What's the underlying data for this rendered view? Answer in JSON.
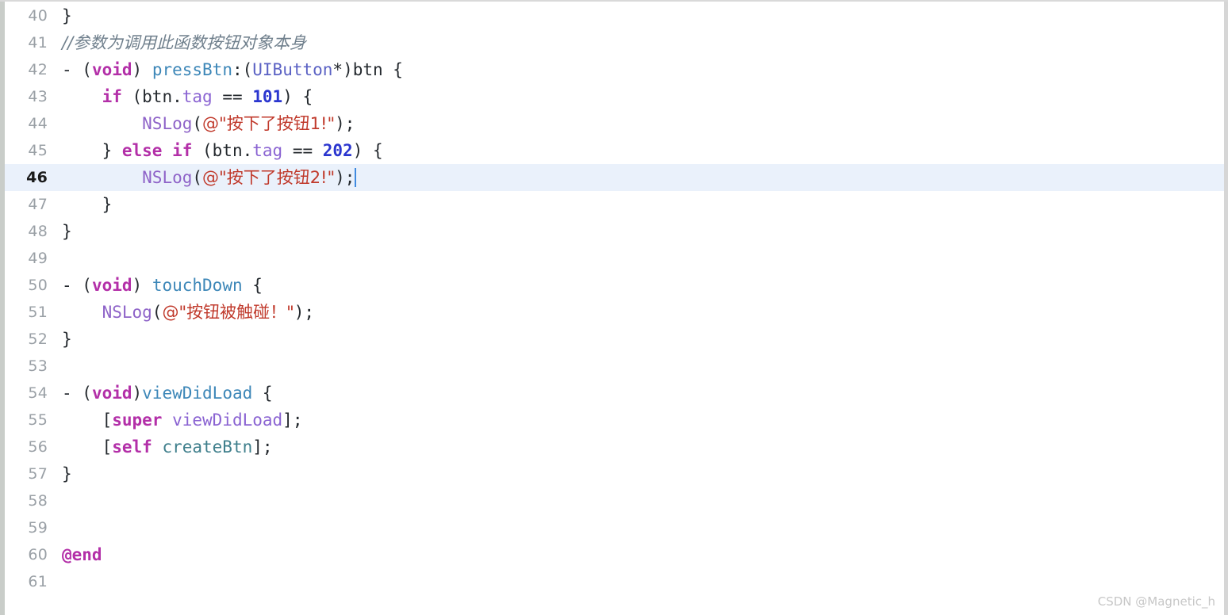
{
  "editor": {
    "language": "Objective-C",
    "first_line_number": 40,
    "active_line_number": 46,
    "caret_line": 46,
    "colors": {
      "background": "#ffffff",
      "active_line": "#eaf1fb",
      "line_number": "#9aa0a6",
      "active_line_number": "#1a1a1a",
      "caret": "#3f8ae0",
      "keyword": "#b32fa8",
      "method": "#3d87b8",
      "type": "#5b62c4",
      "property": "#8a63d2",
      "number": "#2b36cf",
      "function": "#8e63c8",
      "string": "#c0392b",
      "comment": "#6f7f8c",
      "plain": "#24292e"
    },
    "lines": [
      {
        "number": "40",
        "active": false,
        "tokens": [
          {
            "t": "}",
            "c": "t-plain"
          }
        ]
      },
      {
        "number": "41",
        "active": false,
        "tokens": [
          {
            "t": "//参数为调用此函数按钮对象本身",
            "c": "t-comment cjk"
          }
        ]
      },
      {
        "number": "42",
        "active": false,
        "tokens": [
          {
            "t": "- (",
            "c": "t-plain"
          },
          {
            "t": "void",
            "c": "t-keyword"
          },
          {
            "t": ") ",
            "c": "t-plain"
          },
          {
            "t": "pressBtn",
            "c": "t-method"
          },
          {
            "t": ":(",
            "c": "t-plain"
          },
          {
            "t": "UIButton",
            "c": "t-type"
          },
          {
            "t": "*)btn {",
            "c": "t-plain"
          }
        ]
      },
      {
        "number": "43",
        "active": false,
        "tokens": [
          {
            "t": "    ",
            "c": "t-plain"
          },
          {
            "t": "if",
            "c": "t-keyword"
          },
          {
            "t": " (btn.",
            "c": "t-plain"
          },
          {
            "t": "tag",
            "c": "t-prop"
          },
          {
            "t": " == ",
            "c": "t-plain"
          },
          {
            "t": "101",
            "c": "t-number"
          },
          {
            "t": ") {",
            "c": "t-plain"
          }
        ]
      },
      {
        "number": "44",
        "active": false,
        "tokens": [
          {
            "t": "        ",
            "c": "t-plain"
          },
          {
            "t": "NSLog",
            "c": "t-func"
          },
          {
            "t": "(",
            "c": "t-plain"
          },
          {
            "t": "@\"按下了按钮1!\"",
            "c": "t-string cjk"
          },
          {
            "t": ");",
            "c": "t-plain"
          }
        ]
      },
      {
        "number": "45",
        "active": false,
        "tokens": [
          {
            "t": "    } ",
            "c": "t-plain"
          },
          {
            "t": "else if",
            "c": "t-keyword"
          },
          {
            "t": " (btn.",
            "c": "t-plain"
          },
          {
            "t": "tag",
            "c": "t-prop"
          },
          {
            "t": " == ",
            "c": "t-plain"
          },
          {
            "t": "202",
            "c": "t-number"
          },
          {
            "t": ") {",
            "c": "t-plain"
          }
        ]
      },
      {
        "number": "46",
        "active": true,
        "caret": true,
        "tokens": [
          {
            "t": "        ",
            "c": "t-plain"
          },
          {
            "t": "NSLog",
            "c": "t-func"
          },
          {
            "t": "(",
            "c": "t-plain"
          },
          {
            "t": "@\"按下了按钮2!\"",
            "c": "t-string cjk"
          },
          {
            "t": ");",
            "c": "t-plain"
          }
        ]
      },
      {
        "number": "47",
        "active": false,
        "tokens": [
          {
            "t": "    }",
            "c": "t-plain"
          }
        ]
      },
      {
        "number": "48",
        "active": false,
        "tokens": [
          {
            "t": "}",
            "c": "t-plain"
          }
        ]
      },
      {
        "number": "49",
        "active": false,
        "tokens": []
      },
      {
        "number": "50",
        "active": false,
        "tokens": [
          {
            "t": "- (",
            "c": "t-plain"
          },
          {
            "t": "void",
            "c": "t-keyword"
          },
          {
            "t": ") ",
            "c": "t-plain"
          },
          {
            "t": "touchDown",
            "c": "t-method"
          },
          {
            "t": " {",
            "c": "t-plain"
          }
        ]
      },
      {
        "number": "51",
        "active": false,
        "tokens": [
          {
            "t": "    ",
            "c": "t-plain"
          },
          {
            "t": "NSLog",
            "c": "t-func"
          },
          {
            "t": "(",
            "c": "t-plain"
          },
          {
            "t": "@\"按钮被触碰！\"",
            "c": "t-string cjk"
          },
          {
            "t": ");",
            "c": "t-plain"
          }
        ]
      },
      {
        "number": "52",
        "active": false,
        "tokens": [
          {
            "t": "}",
            "c": "t-plain"
          }
        ]
      },
      {
        "number": "53",
        "active": false,
        "tokens": []
      },
      {
        "number": "54",
        "active": false,
        "tokens": [
          {
            "t": "- (",
            "c": "t-plain"
          },
          {
            "t": "void",
            "c": "t-keyword"
          },
          {
            "t": ")",
            "c": "t-plain"
          },
          {
            "t": "viewDidLoad",
            "c": "t-method"
          },
          {
            "t": " {",
            "c": "t-plain"
          }
        ]
      },
      {
        "number": "55",
        "active": false,
        "tokens": [
          {
            "t": "    [",
            "c": "t-plain"
          },
          {
            "t": "super",
            "c": "t-keyword"
          },
          {
            "t": " ",
            "c": "t-plain"
          },
          {
            "t": "viewDidLoad",
            "c": "t-msgsel"
          },
          {
            "t": "];",
            "c": "t-plain"
          }
        ]
      },
      {
        "number": "56",
        "active": false,
        "tokens": [
          {
            "t": "    [",
            "c": "t-plain"
          },
          {
            "t": "self",
            "c": "t-keyword"
          },
          {
            "t": " ",
            "c": "t-plain"
          },
          {
            "t": "createBtn",
            "c": "t-selector"
          },
          {
            "t": "];",
            "c": "t-plain"
          }
        ]
      },
      {
        "number": "57",
        "active": false,
        "tokens": [
          {
            "t": "}",
            "c": "t-plain"
          }
        ]
      },
      {
        "number": "58",
        "active": false,
        "tokens": []
      },
      {
        "number": "59",
        "active": false,
        "tokens": []
      },
      {
        "number": "60",
        "active": false,
        "tokens": [
          {
            "t": "@end",
            "c": "t-directive"
          }
        ]
      },
      {
        "number": "61",
        "active": false,
        "tokens": []
      }
    ]
  },
  "watermark": {
    "text": "CSDN @Magnetic_h"
  }
}
